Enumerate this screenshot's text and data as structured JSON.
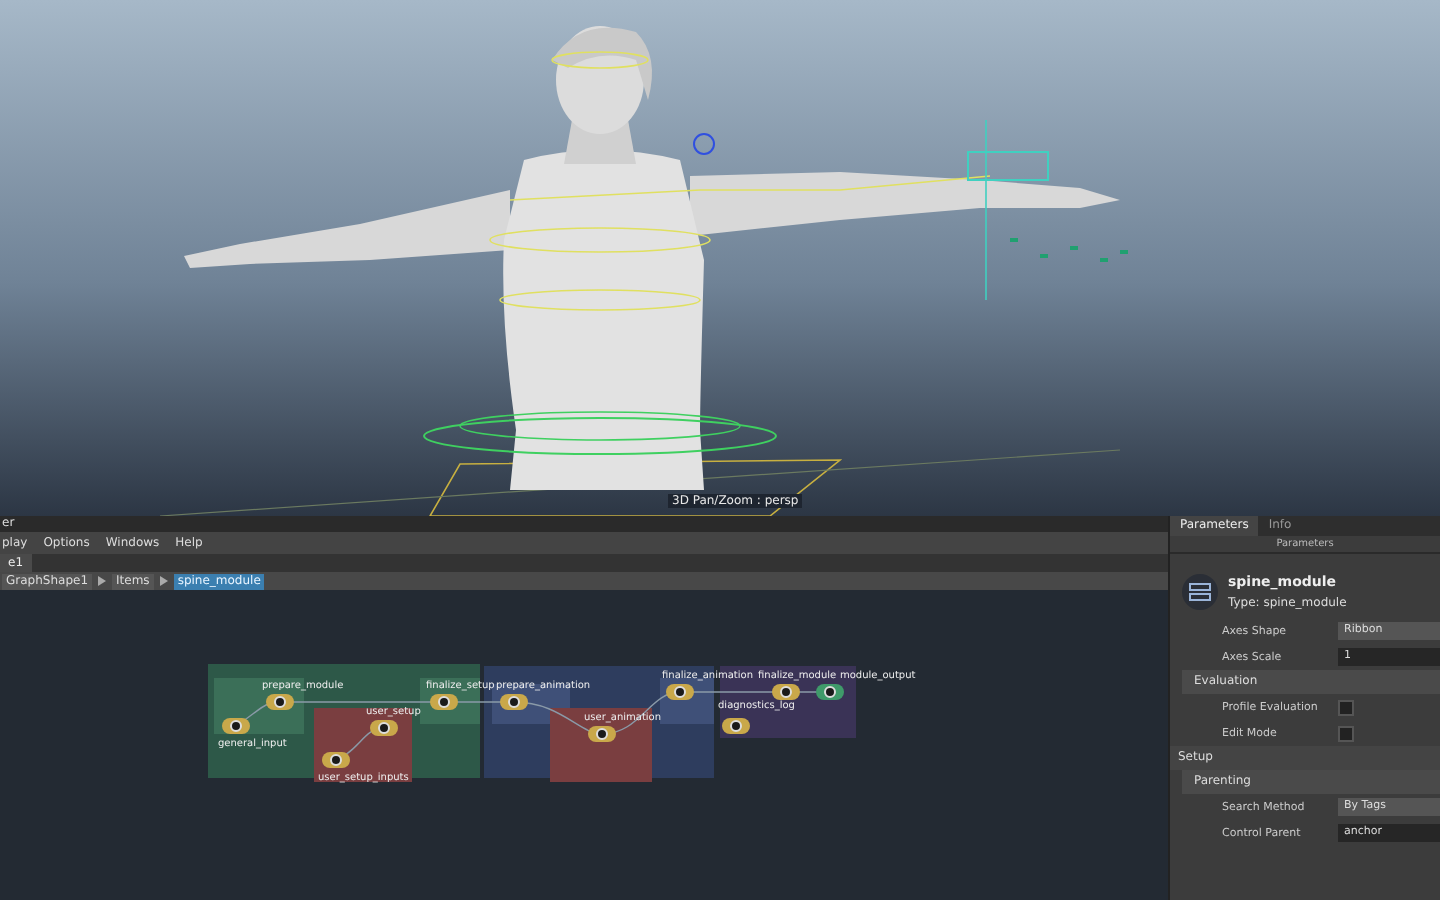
{
  "viewport": {
    "camera_label": "3D Pan/Zoom : persp"
  },
  "editor": {
    "title": "er",
    "menu": [
      "play",
      "Options",
      "Windows",
      "Help"
    ],
    "tabs": [
      {
        "label": "e1",
        "selected": true
      }
    ],
    "breadcrumbs": [
      {
        "label": "GraphShape1",
        "selected": false
      },
      {
        "label": "Items",
        "selected": false
      },
      {
        "label": "spine_module",
        "selected": true
      }
    ],
    "groups": [
      {
        "color": "#2d5848"
      },
      {
        "color": "#2e3d5e"
      },
      {
        "color": "#3a3356"
      }
    ],
    "nodes": [
      {
        "label": "general_input",
        "kind": "input"
      },
      {
        "label": "prepare_module",
        "kind": "step"
      },
      {
        "label": "user_setup",
        "kind": "user"
      },
      {
        "label": "user_setup_inputs",
        "kind": "input"
      },
      {
        "label": "finalize_setup",
        "kind": "step"
      },
      {
        "label": "prepare_animation",
        "kind": "step"
      },
      {
        "label": "user_animation",
        "kind": "user"
      },
      {
        "label": "finalize_animation",
        "kind": "step"
      },
      {
        "label": "diagnostics_log",
        "kind": "input"
      },
      {
        "label": "finalize_module",
        "kind": "step"
      },
      {
        "label": "module_output",
        "kind": "output"
      }
    ]
  },
  "panel": {
    "tabs": [
      {
        "label": "Parameters",
        "selected": true
      },
      {
        "label": "Info",
        "selected": false
      }
    ],
    "header": "Parameters",
    "module_name": "spine_module",
    "module_type": "Type: spine_module",
    "fields": [
      {
        "label": "Axes Shape",
        "value": "Ribbon",
        "kind": "dropdown"
      },
      {
        "label": "Axes Scale",
        "value": "1",
        "kind": "number"
      }
    ],
    "sections": [
      {
        "title": "Evaluation",
        "kind": "subsection",
        "rows": [
          {
            "label": "Profile Evaluation",
            "kind": "checkbox",
            "checked": false
          },
          {
            "label": "Edit Mode",
            "kind": "checkbox",
            "checked": false
          }
        ]
      },
      {
        "title": "Setup",
        "kind": "section"
      },
      {
        "title": "Parenting",
        "kind": "subsection",
        "rows": [
          {
            "label": "Search Method",
            "kind": "dropdown",
            "value": "By Tags"
          },
          {
            "label": "Control Parent",
            "kind": "text",
            "value": "anchor"
          }
        ]
      }
    ]
  }
}
